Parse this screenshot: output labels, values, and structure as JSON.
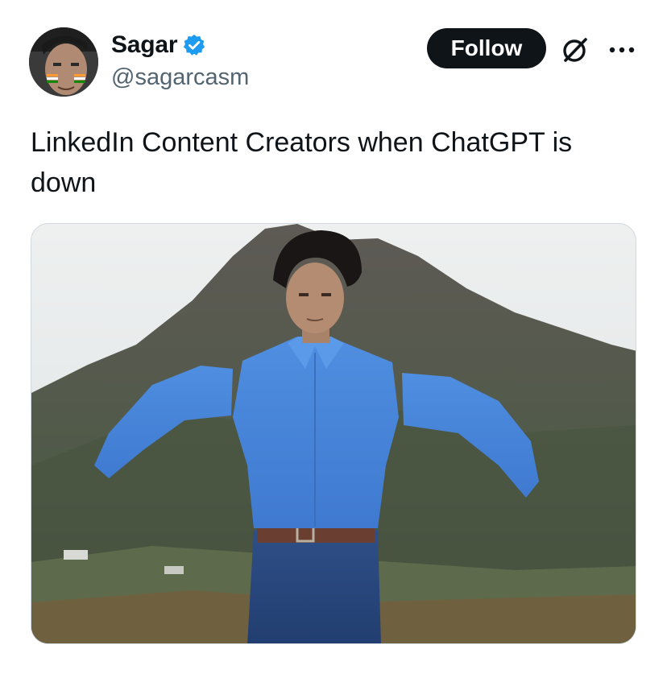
{
  "author": {
    "display_name": "Sagar",
    "handle": "@sagarcasm",
    "verified": true,
    "verified_color": "#1d9bf0",
    "avatar_icon": "user-avatar"
  },
  "actions": {
    "follow_label": "Follow",
    "grok_icon": "grok-icon",
    "more_icon": "more-icon"
  },
  "tweet": {
    "text": "LinkedIn Content Creators when ChatGPT is down"
  },
  "media": {
    "type": "image",
    "subject": "meme-photo"
  },
  "colors": {
    "follow_bg": "#0f1419",
    "handle": "#536471",
    "text": "#0f1419"
  }
}
